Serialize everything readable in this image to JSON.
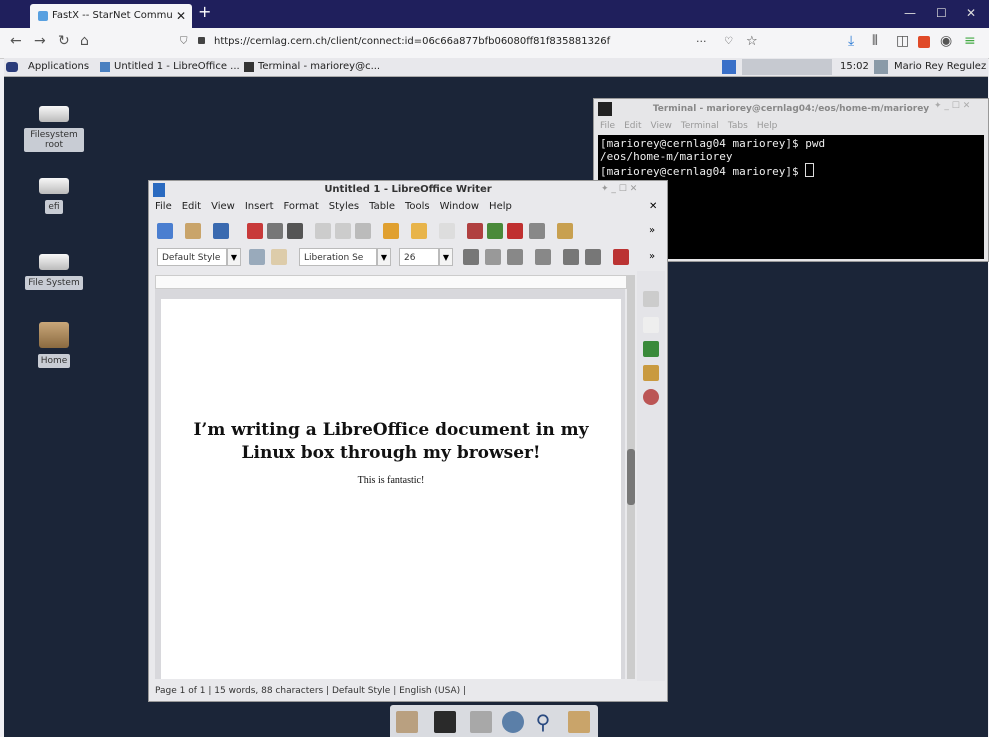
{
  "browser": {
    "tab_title": "FastX -- StarNet Communications",
    "url": "https://cernlag.cern.ch/client/connect:id=06c66a877bfb06080ff81f835881326f",
    "page_actions": "···"
  },
  "panel": {
    "applications": "Applications",
    "task1": "Untitled 1 - LibreOffice ...",
    "task2": "Terminal - mariorey@c...",
    "clock": "15:02",
    "user": "Mario Rey Regulez"
  },
  "desktop_icons": {
    "filesystem_root": "Filesystem root",
    "efi": "efi",
    "file_system": "File System",
    "home": "Home"
  },
  "terminal": {
    "title": "Terminal - mariorey@cernlag04:/eos/home-m/mariorey",
    "menu": [
      "File",
      "Edit",
      "View",
      "Terminal",
      "Tabs",
      "Help"
    ],
    "line1": "[mariorey@cernlag04 mariorey]$ pwd",
    "line2": "/eos/home-m/mariorey",
    "line3": "[mariorey@cernlag04 mariorey]$ "
  },
  "writer": {
    "title": "Untitled 1 - LibreOffice Writer",
    "menu": [
      "File",
      "Edit",
      "View",
      "Insert",
      "Format",
      "Styles",
      "Table",
      "Tools",
      "Window",
      "Help"
    ],
    "paragraph_style": "Default Style",
    "font_name": "Liberation Se",
    "font_size": "26",
    "heading": "I’m writing a LibreOffice document in my Linux box through my browser!",
    "body": "This is fantastic!",
    "status": {
      "page": "Page 1 of 1",
      "words": "15 words, 88 characters",
      "style": "Default Style",
      "language": "English (USA)"
    }
  }
}
